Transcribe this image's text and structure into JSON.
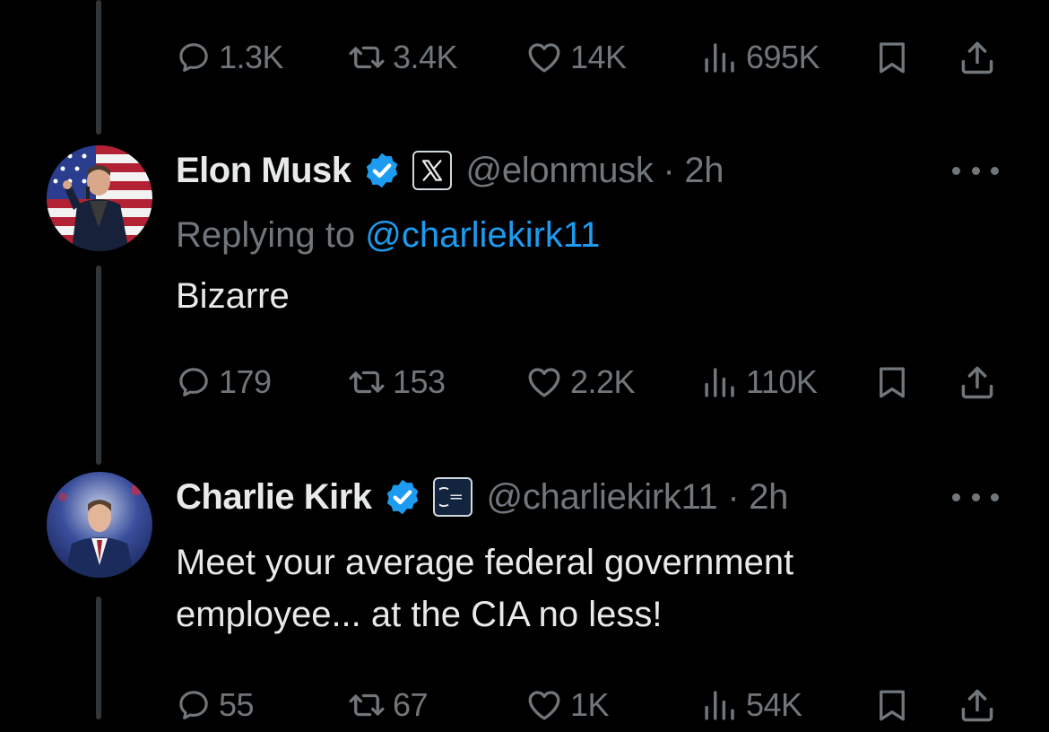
{
  "top_tweet": {
    "replies": "1.3K",
    "reposts": "3.4K",
    "likes": "14K",
    "views": "695K"
  },
  "elon_tweet": {
    "name": "Elon Musk",
    "handle": "@elonmusk",
    "sep": "·",
    "time": "2h",
    "replying_prefix": "Replying to",
    "replying_to": "@charliekirk11",
    "text": "Bizarre",
    "replies": "179",
    "reposts": "153",
    "likes": "2.2K",
    "views": "110K",
    "affiliation_icon": "x-logo-icon"
  },
  "charlie_tweet": {
    "name": "Charlie Kirk",
    "handle": "@charliekirk11",
    "sep": "·",
    "time": "2h",
    "text_line1": "Meet your average federal government",
    "text_line2": "employee... at the CIA no less!",
    "replies": "55",
    "reposts": "67",
    "likes": "1K",
    "views": "54K",
    "affiliation_icon": "turning-point-logo-icon"
  },
  "colors": {
    "background": "#000000",
    "primary_text": "#e7e9ea",
    "secondary_text": "#71767b",
    "accent_blue": "#1d9bf0",
    "thread_line": "#333639"
  }
}
